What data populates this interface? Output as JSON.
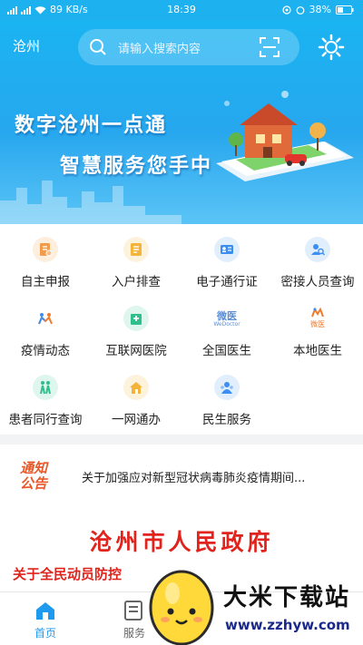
{
  "status_bar": {
    "speed": "89 KB/s",
    "time": "18:39",
    "battery": "38%"
  },
  "header": {
    "city": "沧州",
    "search_placeholder": "请输入搜索内容"
  },
  "banner": {
    "line1": "数字沧州一点通",
    "line2": "智慧服务您手中"
  },
  "services": [
    {
      "label": "自主申报",
      "icon": "declare-icon",
      "color": "#f29b4b",
      "bg": "#fdeedd"
    },
    {
      "label": "入户排查",
      "icon": "checklist-icon",
      "color": "#f3b43c",
      "bg": "#fdf3dd"
    },
    {
      "label": "电子通行证",
      "icon": "id-card-icon",
      "color": "#3c8ff0",
      "bg": "#e1eefc"
    },
    {
      "label": "密接人员查询",
      "icon": "contacts-icon",
      "color": "#3c8ff0",
      "bg": "#e1eefc"
    },
    {
      "label": "疫情动态",
      "icon": "epidemic-icon",
      "color": "#f07b2c",
      "bg": "#ffffff"
    },
    {
      "label": "互联网医院",
      "icon": "hospital-icon",
      "color": "#2fbf8b",
      "bg": "#dff6ee"
    },
    {
      "label": "全国医生",
      "icon": "weiyi-logo-icon",
      "color": "#5a8fd8",
      "bg": "#ffffff",
      "text": "微医",
      "sub": "WeDoctor"
    },
    {
      "label": "本地医生",
      "icon": "local-doctor-icon",
      "color": "#f07b2c",
      "bg": "#ffffff",
      "text": "微医"
    },
    {
      "label": "患者同行查询",
      "icon": "companion-icon",
      "color": "#2fbf8b",
      "bg": "#dff6ee"
    },
    {
      "label": "一网通办",
      "icon": "home-service-icon",
      "color": "#f3b43c",
      "bg": "#fdf3dd"
    },
    {
      "label": "民生服务",
      "icon": "people-service-icon",
      "color": "#3c8ff0",
      "bg": "#e1eefc"
    }
  ],
  "notice": {
    "badge_line1": "通知",
    "badge_line2": "公告",
    "text": "关于加强应对新型冠状病毒肺炎疫情期间..."
  },
  "gov_banner": {
    "title": "沧州市人民政府",
    "subtitle": "关于全民动员防控"
  },
  "tabs": [
    {
      "label": "首页",
      "icon": "home-icon",
      "active": true
    },
    {
      "label": "服务",
      "icon": "service-icon",
      "active": false
    }
  ],
  "watermark": {
    "title": "大米下载站",
    "url": "www.zzhyw.com"
  },
  "colors": {
    "primary": "#1eb1f0",
    "accent_red": "#e0231c",
    "tab_active": "#1e9bef"
  }
}
